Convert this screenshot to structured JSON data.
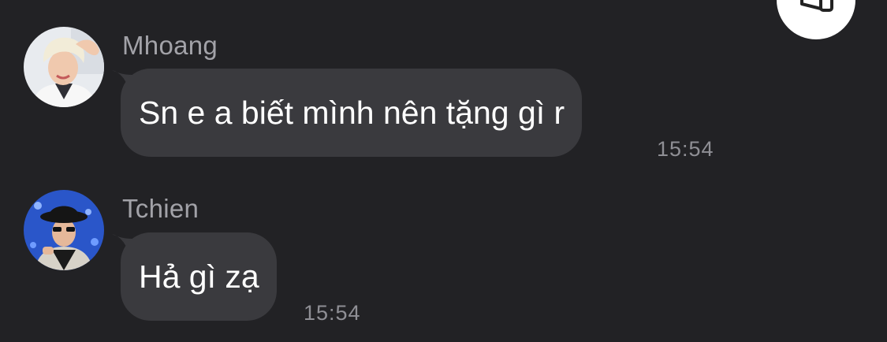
{
  "fab": {
    "icon": "megaphone-icon"
  },
  "messages": [
    {
      "sender": "Mhoang",
      "text": "Sn e a biết mình nên tặng gì r",
      "time": "15:54",
      "avatar_colors": {
        "bg": "#e9ecef",
        "hair": "#f2ecd8",
        "skin": "#f0c9ae",
        "shirt": "#f7f7f7"
      }
    },
    {
      "sender": "Tchien",
      "text": "Hả gì zạ",
      "time": "15:54",
      "avatar_colors": {
        "bg": "#2a56c9",
        "hat": "#151515",
        "skin": "#e5b89a",
        "shirt": "#d7d2c8"
      }
    }
  ]
}
